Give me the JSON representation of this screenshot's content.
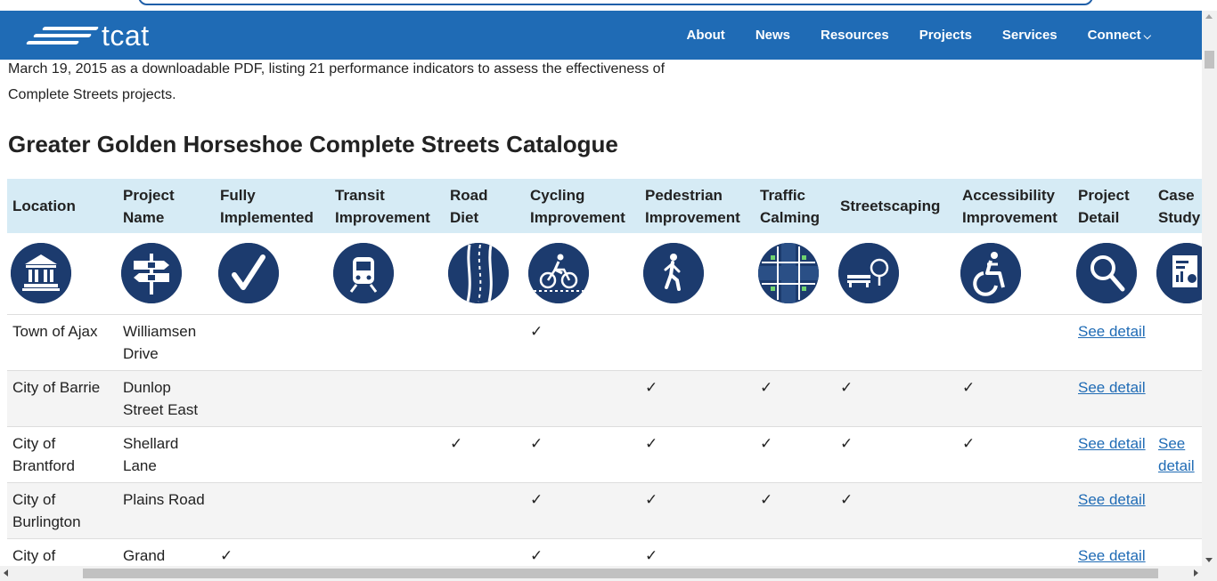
{
  "header": {
    "logo_text": "tcat",
    "nav": [
      {
        "label": "About"
      },
      {
        "label": "News"
      },
      {
        "label": "Resources"
      },
      {
        "label": "Projects"
      },
      {
        "label": "Services"
      },
      {
        "label": "Connect"
      }
    ],
    "brand_color": "#1f6bb5"
  },
  "intro": {
    "line1": "March 19, 2015 as a downloadable PDF, listing 21 performance indicators to assess the effectiveness of",
    "line2": "Complete Streets projects."
  },
  "section_title": "Greater Golden Horseshoe Complete Streets Catalogue",
  "table": {
    "columns": [
      {
        "label_1": "Location",
        "label_2": "",
        "icon": "government-building-icon"
      },
      {
        "label_1": "Project",
        "label_2": "Name",
        "icon": "signpost-icon"
      },
      {
        "label_1": "Fully",
        "label_2": "Implemented",
        "icon": "checkmark-icon"
      },
      {
        "label_1": "Transit",
        "label_2": "Improvement",
        "icon": "train-icon"
      },
      {
        "label_1": "Road",
        "label_2": "Diet",
        "icon": "road-lanes-icon"
      },
      {
        "label_1": "Cycling",
        "label_2": "Improvement",
        "icon": "bicycle-icon"
      },
      {
        "label_1": "Pedestrian",
        "label_2": "Improvement",
        "icon": "walking-person-icon"
      },
      {
        "label_1": "Traffic",
        "label_2": "Calming",
        "icon": "intersection-icon"
      },
      {
        "label_1": "Streetscaping",
        "label_2": "",
        "icon": "bench-tree-icon"
      },
      {
        "label_1": "Accessibility",
        "label_2": "Improvement",
        "icon": "wheelchair-icon"
      },
      {
        "label_1": "Project",
        "label_2": "Detail",
        "icon": "magnifier-icon"
      },
      {
        "label_1": "Case",
        "label_2": "Study",
        "icon": "document-chart-icon"
      }
    ],
    "check_glyph": "✓",
    "rows": [
      {
        "location": "Town of Ajax",
        "project": "Williamsen Drive",
        "cells": [
          "",
          "",
          "",
          "✓",
          "",
          "",
          "",
          "",
          "See detail",
          ""
        ]
      },
      {
        "location": "City of Barrie",
        "project": "Dunlop Street East",
        "cells": [
          "",
          "",
          "",
          "",
          "✓",
          "✓",
          "✓",
          "✓",
          "See detail",
          ""
        ]
      },
      {
        "location": "City of Brantford",
        "project": "Shellard Lane",
        "cells": [
          "",
          "",
          "✓",
          "✓",
          "✓",
          "✓",
          "✓",
          "✓",
          "See detail",
          "See detail"
        ]
      },
      {
        "location": "City of Burlington",
        "project": "Plains Road",
        "cells": [
          "",
          "",
          "",
          "✓",
          "✓",
          "✓",
          "✓",
          "",
          "See detail",
          ""
        ]
      },
      {
        "location": "City of Cambridge",
        "project": "Grand Avenue",
        "cells": [
          "✓",
          "",
          "",
          "✓",
          "✓",
          "",
          "",
          "",
          "See detail",
          ""
        ]
      }
    ]
  }
}
